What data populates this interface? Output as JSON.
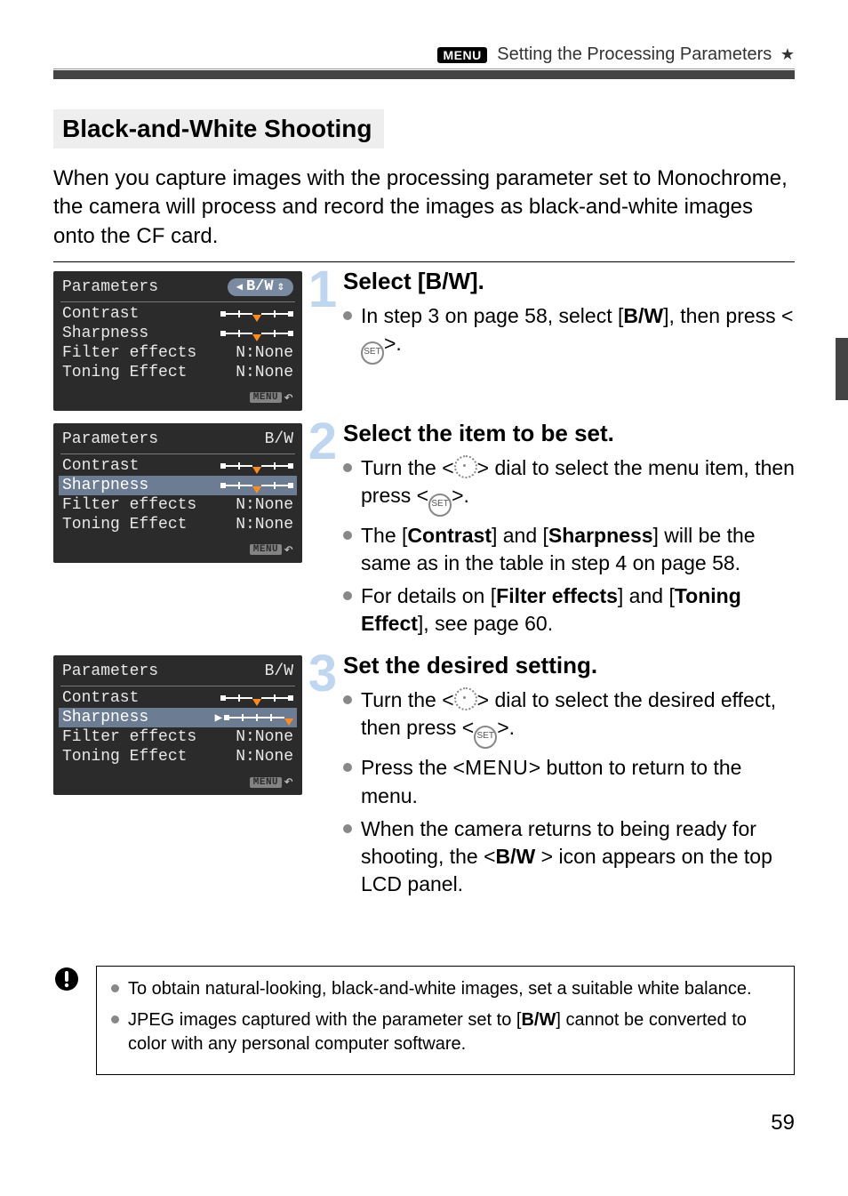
{
  "header": {
    "menu_badge": "MENU",
    "title_tail": "Setting the Processing Parameters",
    "star": "★"
  },
  "subtitle": "Black-and-White Shooting",
  "intro": "When you capture images with the processing parameter set to Monochrome, the camera will process and record the images as black-and-white images onto the CF card.",
  "lcd": {
    "parameters_label": "Parameters",
    "bw_label": "B/W",
    "bw_pill": "B/W",
    "rows": {
      "contrast": "Contrast",
      "sharpness": "Sharpness",
      "filter": "Filter effects",
      "toning": "Toning Effect"
    },
    "none_filter": "N:None",
    "none_toning": "N:None",
    "footer_badge": "MENU"
  },
  "steps": [
    {
      "num": "1",
      "title": "Select [B/W].",
      "bullets": [
        {
          "pre": "In step 3 on page 58, select [",
          "bold1": "B/W",
          "mid": "], then press <",
          "icon": "set",
          "post": ">."
        }
      ]
    },
    {
      "num": "2",
      "title": "Select the item to be set.",
      "bullets": [
        {
          "pre": "Turn the <",
          "icon": "dial",
          "mid2": "> dial to select the menu item, then press <",
          "icon2": "set",
          "post": ">."
        },
        {
          "pre": "The [",
          "bold1": "Contrast",
          "mid": "] and [",
          "bold2": "Sharpness",
          "post": "] will be the same as in the table in step 4 on page 58."
        },
        {
          "pre": "For details on [",
          "bold1": "Filter effects",
          "mid": "] and [",
          "bold2": "Toning Effect",
          "post": "], see page 60."
        }
      ]
    },
    {
      "num": "3",
      "title": "Set the desired setting.",
      "bullets": [
        {
          "pre": "Turn the <",
          "icon": "dial",
          "mid2": "> dial to select the desired effect, then press <",
          "icon2": "set",
          "post": ">."
        },
        {
          "pre": "Press the <",
          "menuword": "MENU",
          "post": "> button to return to the menu."
        },
        {
          "pre": "When the camera returns to being ready for shooting, the <",
          "bwword": "B/W",
          "post": " > icon appears on the top LCD panel."
        }
      ]
    }
  ],
  "caution": [
    "To obtain natural-looking, black-and-white images, set a suitable white balance.",
    {
      "pre": "JPEG images captured with the parameter set to [",
      "bold": "B/W",
      "post": "] cannot be converted to color with any personal computer software."
    }
  ],
  "page_number": "59"
}
